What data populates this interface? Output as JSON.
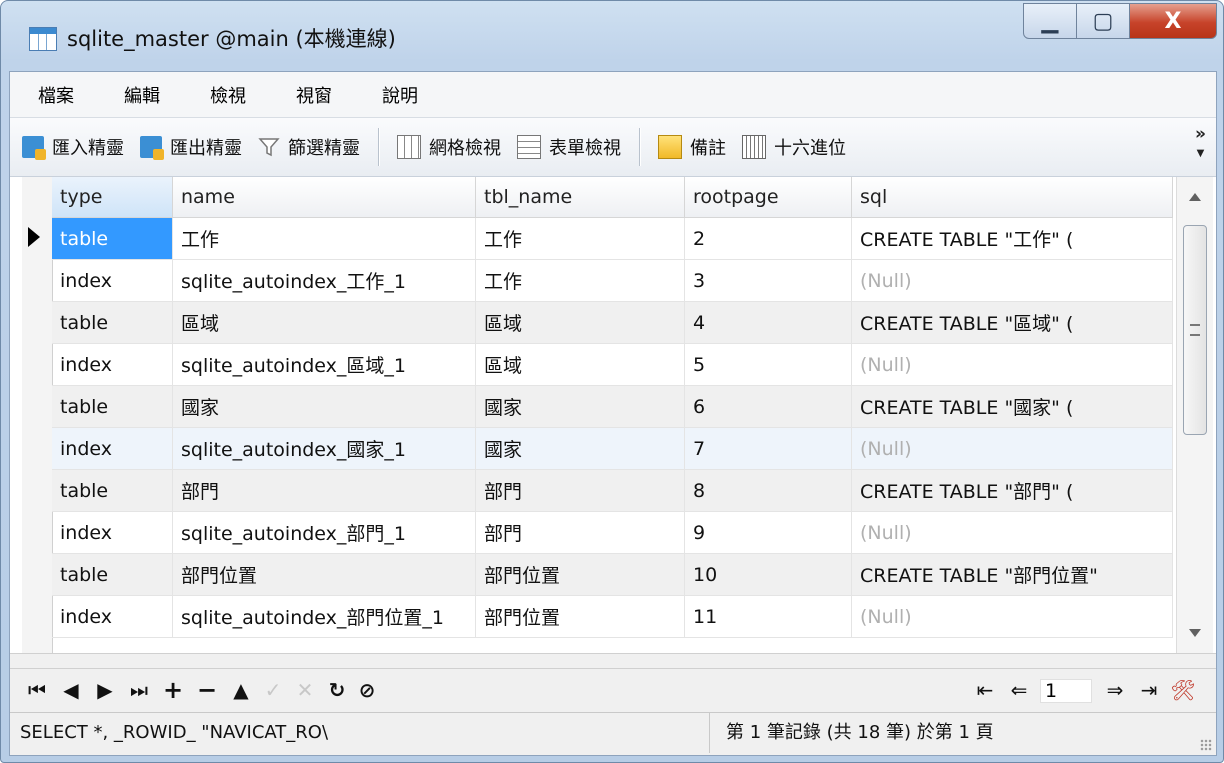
{
  "window": {
    "title": "sqlite_master @main (本機連線)",
    "minimize_glyph": "▁",
    "maximize_glyph": "▢",
    "close_glyph": "X"
  },
  "menu": [
    "檔案",
    "編輯",
    "檢視",
    "視窗",
    "說明"
  ],
  "toolbar": {
    "import_wizard": "匯入精靈",
    "export_wizard": "匯出精靈",
    "filter_wizard": "篩選精靈",
    "grid_view": "網格檢視",
    "form_view": "表單檢視",
    "memo": "備註",
    "hex": "十六進位",
    "overflow": "»"
  },
  "grid": {
    "columns": [
      "type",
      "name",
      "tbl_name",
      "rootpage",
      "sql"
    ],
    "rows": [
      [
        "table",
        "工作",
        "工作",
        "2",
        "CREATE TABLE \"工作\" ("
      ],
      [
        "index",
        "sqlite_autoindex_工作_1",
        "工作",
        "3",
        "(Null)"
      ],
      [
        "table",
        "區域",
        "區域",
        "4",
        "CREATE TABLE \"區域\" ("
      ],
      [
        "index",
        "sqlite_autoindex_區域_1",
        "區域",
        "5",
        "(Null)"
      ],
      [
        "table",
        "國家",
        "國家",
        "6",
        "CREATE TABLE \"國家\" ("
      ],
      [
        "index",
        "sqlite_autoindex_國家_1",
        "國家",
        "7",
        "(Null)"
      ],
      [
        "table",
        "部門",
        "部門",
        "8",
        "CREATE TABLE \"部門\" ("
      ],
      [
        "index",
        "sqlite_autoindex_部門_1",
        "部門",
        "9",
        "(Null)"
      ],
      [
        "table",
        "部門位置",
        "部門位置",
        "10",
        "CREATE TABLE \"部門位置\""
      ],
      [
        "index",
        "sqlite_autoindex_部門位置_1",
        "部門位置",
        "11",
        "(Null)"
      ]
    ],
    "selected_color": "#3399ff"
  },
  "nav": {
    "first": "⏮",
    "prev": "◀",
    "next": "▶",
    "last": "⏭",
    "add": "+",
    "delete": "−",
    "up": "▲",
    "apply": "✓",
    "cancel": "✕",
    "refresh": "↻",
    "stop": "⊘",
    "page_first": "⇤",
    "page_prev": "⇐",
    "page_value": "1",
    "page_next": "⇒",
    "page_last": "⇥",
    "tools": "🛠"
  },
  "status": {
    "query": "SELECT *, _ROWID_ \"NAVICAT_RO\\",
    "record_info": "第 1 筆記錄 (共 18 筆) 於第 1 頁"
  }
}
